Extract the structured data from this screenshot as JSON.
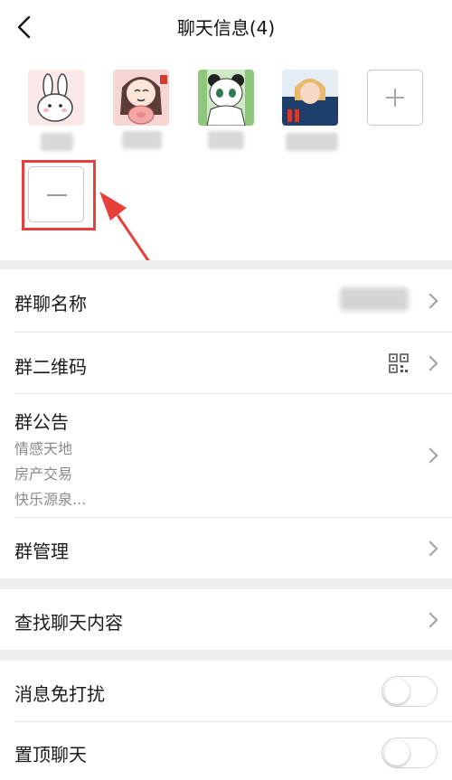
{
  "header": {
    "title": "聊天信息(4)"
  },
  "members": {
    "avatars": [
      {
        "icon": "bunny-avatar-icon",
        "bg": "#fbe9ea"
      },
      {
        "icon": "girl-pig-avatar-icon",
        "bg": "#f6d6d4"
      },
      {
        "icon": "panda-girl-avatar-icon",
        "bg": "#cfe9c6"
      },
      {
        "icon": "photo-girl-avatar-icon",
        "bg": "#e9f0f7"
      }
    ],
    "add_icon": "plus-icon",
    "remove_icon": "minus-icon",
    "highlight_color": "#e6403a"
  },
  "settings": {
    "group_name": {
      "label": "群聊名称"
    },
    "qr_code": {
      "label": "群二维码",
      "icon": "qr-code-icon"
    },
    "announcement": {
      "label": "群公告",
      "lines": [
        "情感天地",
        "房产交易",
        "快乐源泉..."
      ]
    },
    "manage": {
      "label": "群管理"
    },
    "search": {
      "label": "查找聊天内容"
    },
    "mute": {
      "label": "消息免打扰",
      "on": false
    },
    "pin": {
      "label": "置顶聊天",
      "on": false
    }
  }
}
